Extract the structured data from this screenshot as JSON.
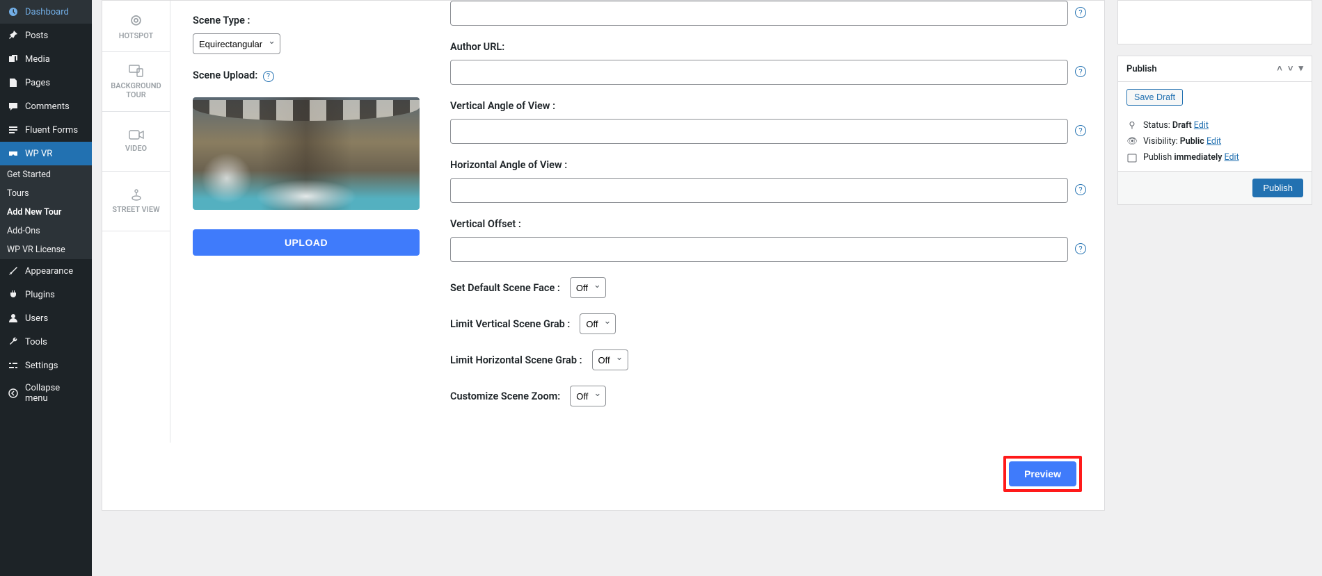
{
  "sidebar": {
    "dashboard": "Dashboard",
    "posts": "Posts",
    "media": "Media",
    "pages": "Pages",
    "comments": "Comments",
    "fluentforms": "Fluent Forms",
    "wpvr": "WP VR",
    "sub_getstarted": "Get Started",
    "sub_tours": "Tours",
    "sub_addnew": "Add New Tour",
    "sub_addons": "Add-Ons",
    "sub_license": "WP VR License",
    "appearance": "Appearance",
    "plugins": "Plugins",
    "users": "Users",
    "tools": "Tools",
    "settings": "Settings",
    "collapse": "Collapse menu"
  },
  "vtabs": {
    "hotspot": "HOTSPOT",
    "bgtour": "BACKGROUND TOUR",
    "video": "VIDEO",
    "streetview": "STREET VIEW"
  },
  "fields": {
    "scene_type_label": "Scene Type :",
    "scene_type_value": "Equirectangular",
    "scene_upload_label": "Scene Upload:",
    "upload_btn": "UPLOAD",
    "author_url": "Author URL:",
    "vaov": "Vertical Angle of View :",
    "haov": "Horizontal Angle of View :",
    "voffset": "Vertical Offset :",
    "default_face_label": "Set Default Scene Face :",
    "default_face_value": "Off",
    "limit_v_label": "Limit Vertical Scene Grab :",
    "limit_v_value": "Off",
    "limit_h_label": "Limit Horizontal Scene Grab :",
    "limit_h_value": "Off",
    "zoom_label": "Customize Scene Zoom:",
    "zoom_value": "Off",
    "preview_btn": "Preview"
  },
  "publish": {
    "title": "Publish",
    "save_draft": "Save Draft",
    "status_label": "Status:",
    "status_value": "Draft",
    "visibility_label": "Visibility:",
    "visibility_value": "Public",
    "schedule_label": "Publish",
    "schedule_value": "immediately",
    "edit": "Edit",
    "publish_btn": "Publish"
  }
}
